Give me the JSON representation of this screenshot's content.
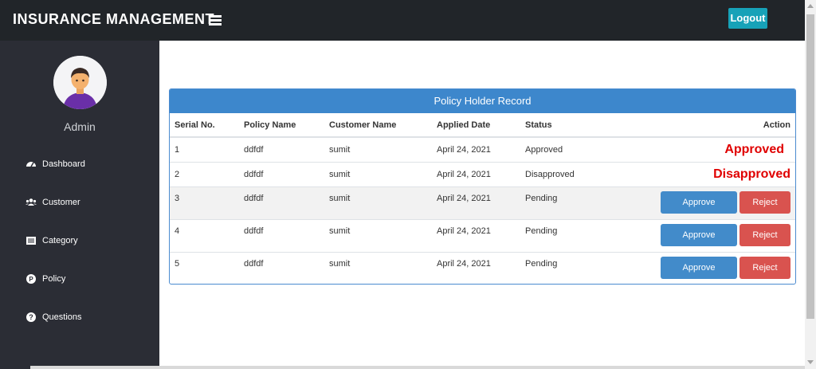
{
  "header": {
    "brand": "INSURANCE MANAGEMENT",
    "logout_label": "Logout"
  },
  "sidebar": {
    "user_name": "Admin",
    "items": [
      {
        "label": "Dashboard",
        "icon": "dashboard-icon"
      },
      {
        "label": "Customer",
        "icon": "users-icon"
      },
      {
        "label": "Category",
        "icon": "list-icon"
      },
      {
        "label": "Policy",
        "icon": "policy-icon"
      },
      {
        "label": "Questions",
        "icon": "question-icon"
      }
    ]
  },
  "card": {
    "title": "Policy Holder Record",
    "columns": [
      "Serial No.",
      "Policy Name",
      "Customer Name",
      "Applied Date",
      "Status",
      "Action"
    ],
    "rows": [
      {
        "serial": "1",
        "policy": "ddfdf",
        "customer": "sumit",
        "date": "April 24, 2021",
        "status": "Approved",
        "action_text": "Approved"
      },
      {
        "serial": "2",
        "policy": "ddfdf",
        "customer": "sumit",
        "date": "April 24, 2021",
        "status": "Disapproved",
        "action_text": "Disapproved"
      },
      {
        "serial": "3",
        "policy": "ddfdf",
        "customer": "sumit",
        "date": "April 24, 2021",
        "status": "Pending",
        "approve_label": "Approve",
        "reject_label": "Reject"
      },
      {
        "serial": "4",
        "policy": "ddfdf",
        "customer": "sumit",
        "date": "April 24, 2021",
        "status": "Pending",
        "approve_label": "Approve",
        "reject_label": "Reject"
      },
      {
        "serial": "5",
        "policy": "ddfdf",
        "customer": "sumit",
        "date": "April 24, 2021",
        "status": "Pending",
        "approve_label": "Approve",
        "reject_label": "Reject"
      }
    ]
  },
  "colors": {
    "topbar": "#212529",
    "sidebar": "#2b2d35",
    "card_header": "#3d87cc",
    "approve": "#428bca",
    "reject": "#d9534f",
    "status_text": "#e00000",
    "logout": "#17a2b8"
  }
}
